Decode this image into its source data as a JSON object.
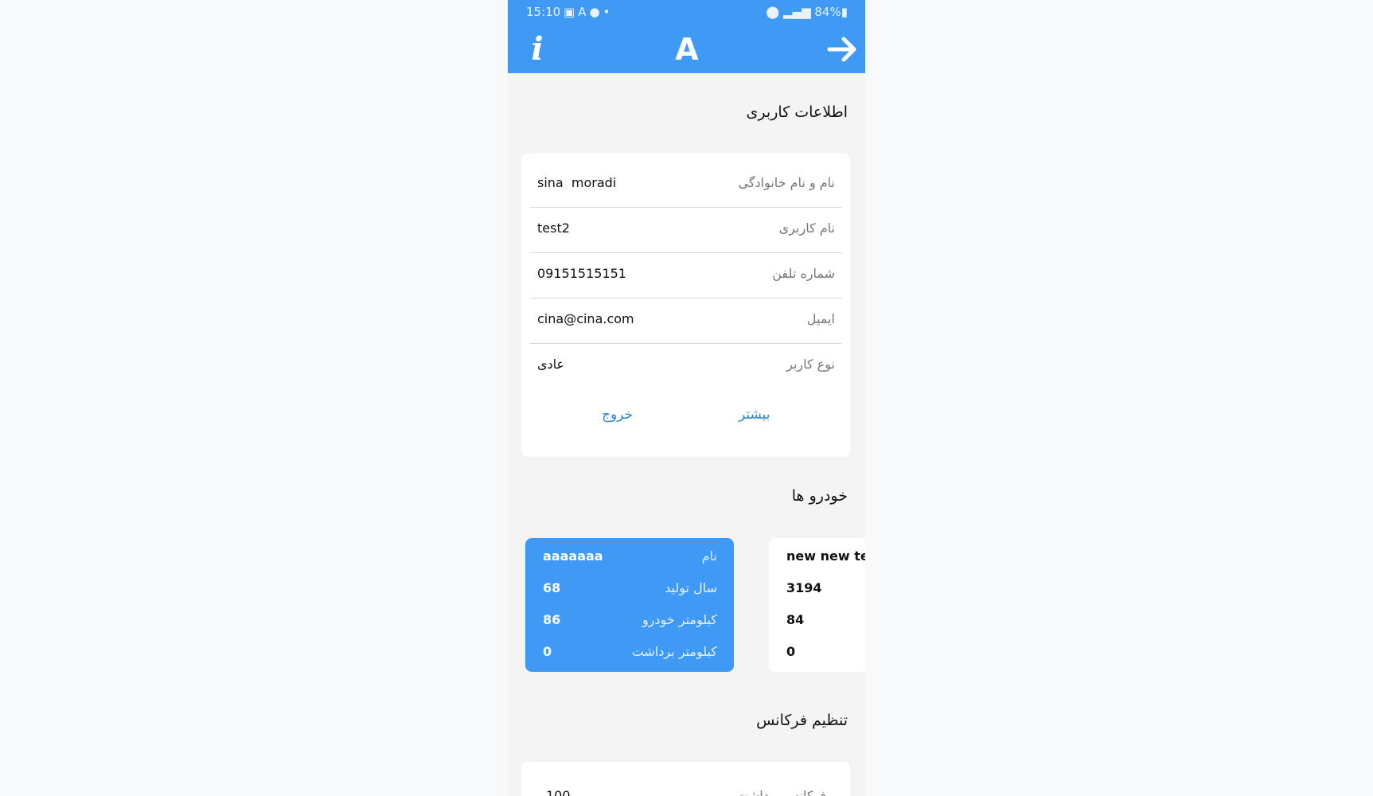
{
  "status_bar": {
    "time": "15:10",
    "battery": "84%",
    "icons": [
      "image-icon",
      "app-a-icon",
      "android-icon",
      "dot-icon",
      "location-icon",
      "signal-icon",
      "battery-icon"
    ]
  },
  "app_bar": {
    "info_icon": "i",
    "logo_letter": "A",
    "color": "#3e9af4"
  },
  "user_section": {
    "title": "اطلاعات کاربری",
    "rows": [
      {
        "label": "نام و نام خانوادگی",
        "value": "sina  moradi"
      },
      {
        "label": "نام کاربری",
        "value": "test2"
      },
      {
        "label": "شماره تلفن",
        "value": "09151515151"
      },
      {
        "label": "ایمیل",
        "value": "cina@cina.com"
      },
      {
        "label": "نوع کاربر",
        "value": "عادی"
      }
    ],
    "more_label": "بیشتر",
    "logout_label": "خروج"
  },
  "cars_section": {
    "title": "خودرو ها",
    "field_labels": [
      "نام",
      "سال تولید",
      "کیلومتر خودرو",
      "کیلومتر برداشت"
    ],
    "cars": [
      {
        "name": "aaaaaaa",
        "year": "68",
        "km": "86",
        "km_harvest": "0"
      },
      {
        "name": "new new test",
        "year": "3194",
        "km": "84",
        "km_harvest": "0"
      }
    ]
  },
  "frequency_section": {
    "title": "تنظیم فرکانس",
    "label": "فرکانس برداشت",
    "value": "100"
  }
}
